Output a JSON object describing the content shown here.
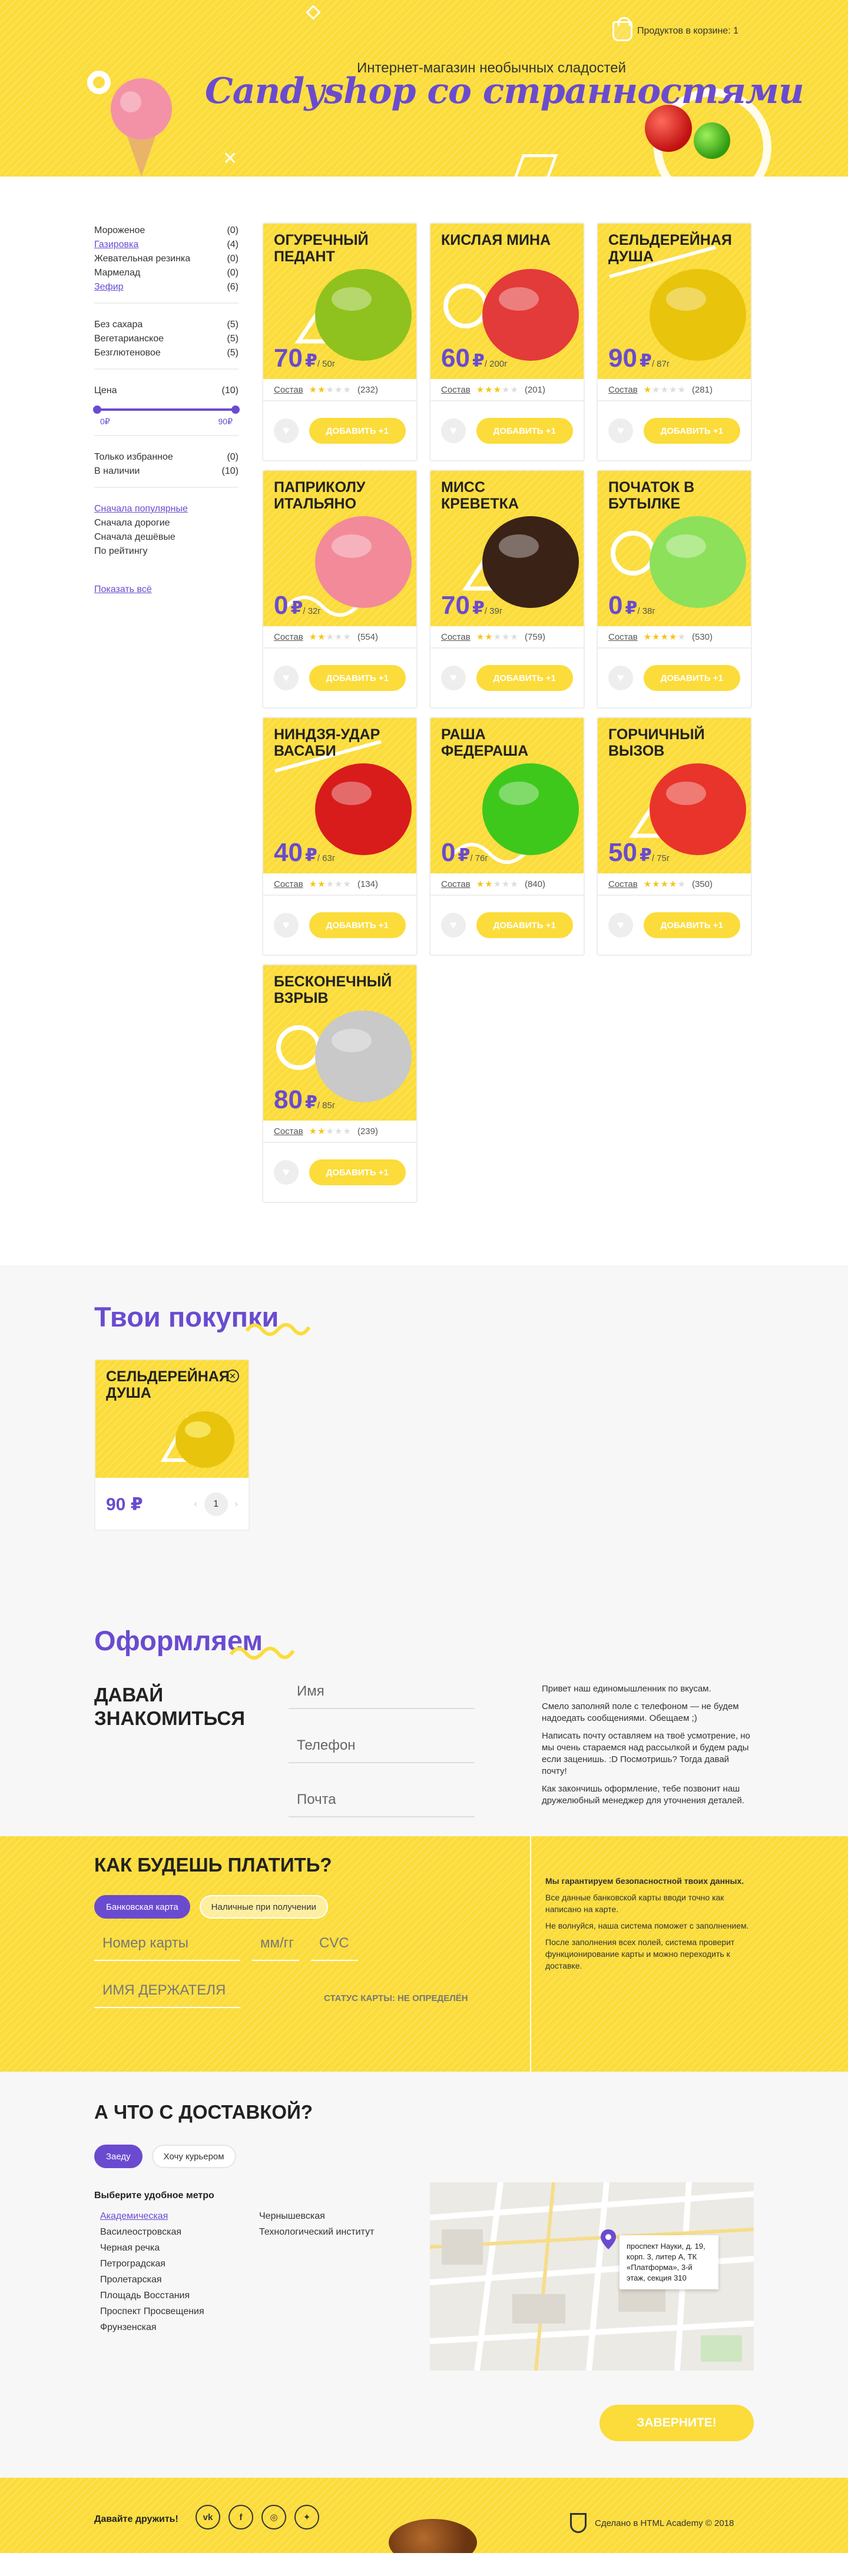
{
  "header": {
    "cart_text": "Продуктов в корзине: 1",
    "tagline": "Интернет-магазин необычных сладостей",
    "logo": "Candyshop со странностями"
  },
  "filters": {
    "categories": [
      {
        "label": "Мороженое",
        "count": "(0)"
      },
      {
        "label": "Газировка",
        "count": "(4)"
      },
      {
        "label": "Жевательная резинка",
        "count": "(0)"
      },
      {
        "label": "Мармелад",
        "count": "(0)"
      },
      {
        "label": "Зефир",
        "count": "(6)"
      }
    ],
    "diet": [
      {
        "label": "Без сахара",
        "count": "(5)"
      },
      {
        "label": "Вегетарианское",
        "count": "(5)"
      },
      {
        "label": "Безглютеновое",
        "count": "(5)"
      }
    ],
    "price_label": "Цена",
    "price_count": "(10)",
    "price_min": "0₽",
    "price_max": "90₽",
    "other": [
      {
        "label": "Только избранное",
        "count": "(0)"
      },
      {
        "label": "В наличии",
        "count": "(10)"
      }
    ],
    "sort": [
      "Сначала популярные",
      "Сначала дорогие",
      "Сначала дешёвые",
      "По рейтингу"
    ],
    "show_all": "Показать всё"
  },
  "products": [
    {
      "name": "Огуречный педант",
      "price": "70",
      "weight": "/ 50г",
      "rating": 2,
      "votes": "(232)",
      "color": "#8fc21e"
    },
    {
      "name": "Кислая мина",
      "price": "60",
      "weight": "/ 200г",
      "rating": 3,
      "votes": "(201)",
      "color": "#e33a3a"
    },
    {
      "name": "Сельдерейная душа",
      "price": "90",
      "weight": "/ 87г",
      "rating": 1,
      "votes": "(281)",
      "color": "#e8c40d"
    },
    {
      "name": "Паприколу итальяно",
      "price": "0",
      "weight": "/ 32г",
      "rating": 2,
      "votes": "(554)",
      "color": "#f28a9a"
    },
    {
      "name": "Мисс креветка",
      "price": "70",
      "weight": "/ 39г",
      "rating": 2,
      "votes": "(759)",
      "color": "#3a2217"
    },
    {
      "name": "Початок в бутылке",
      "price": "0",
      "weight": "/ 38г",
      "rating": 4,
      "votes": "(530)",
      "color": "#8de05a"
    },
    {
      "name": "Ниндзя-удар васаби",
      "price": "40",
      "weight": "/ 63г",
      "rating": 2,
      "votes": "(134)",
      "color": "#d81c1c"
    },
    {
      "name": "Раша федераша",
      "price": "0",
      "weight": "/ 76г",
      "rating": 2,
      "votes": "(840)",
      "color": "#3ec81c"
    },
    {
      "name": "Горчичный вызов",
      "price": "50",
      "weight": "/ 75г",
      "rating": 4,
      "votes": "(350)",
      "color": "#e8342a"
    },
    {
      "name": "Бесконечный взрыв",
      "price": "80",
      "weight": "/ 85г",
      "rating": 2,
      "votes": "(239)",
      "color": "#c9c9c9"
    }
  ],
  "card_labels": {
    "composition": "Состав",
    "add": "Добавить +1",
    "currency": "₽"
  },
  "purchases": {
    "title": "Твои покупки",
    "item_name": "Сельдерейная душа",
    "item_price": "90 ₽",
    "item_qty": "1"
  },
  "order": {
    "title": "Оформляем",
    "meet": "Давай знакомиться",
    "fields": [
      "Имя",
      "Телефон",
      "Почта"
    ],
    "note": [
      "Привет наш единомышленник по вкусам.",
      "Смело заполняй поле с телефоном — не будем надоедать сообщениями. Обещаем ;)",
      "Написать почту оставляем на твоё усмотрение, но мы очень стараемся над рассылкой и будем рады если заценишь. :D Посмотришь? Тогда давай почту!",
      "Как закончишь оформление, тебе позвонит наш дружелюбный менеджер для уточнения деталей."
    ]
  },
  "payment": {
    "title": "Как будешь платить?",
    "tabs": [
      "Банковская карта",
      "Наличные при получении"
    ],
    "card_number": "Номер карты",
    "expiry": "мм/гг",
    "cvc": "CVC",
    "holder": "ИМЯ ДЕРЖАТЕЛЯ",
    "status": "Статус карты: не определён",
    "note": [
      "Мы гарантируем безопасностной твоих данных.",
      "Все данные банковской карты вводи точно как написано на карте.",
      "Не волнуйся, наша система поможет с заполнением.",
      "После заполнения всех полей, система проверит функционирование карты и можно переходить к доставке."
    ]
  },
  "delivery": {
    "title": "А что с доставкой?",
    "tabs": [
      "Заеду",
      "Хочу курьером"
    ],
    "metro_title": "Выберите удобное метро",
    "metro_col1": [
      "Академическая",
      "Василеостровская",
      "Черная речка",
      "Петроградская",
      "Пролетарская",
      "Площадь Восстания",
      "Проспект Просвещения",
      "Фрунзенская"
    ],
    "metro_col2": [
      "Чернышевская",
      "Технологический институт"
    ],
    "address": "проспект Науки, д. 19, корп. 3, литер А, ТК «Платформа», 3-й этаж, секция 310",
    "submit": "Заверните!"
  },
  "footer": {
    "friends": "Давайте дружить!",
    "socials": [
      "vk-icon",
      "facebook-icon",
      "instagram-icon",
      "twitter-icon"
    ],
    "social_glyphs": [
      "vk",
      "f",
      "◎",
      "✦"
    ],
    "copyright": "Сделано в HTML Academy © 2018"
  },
  "colors": {
    "accent": "#6a4bd0",
    "brand_yellow": "#fbdc3a",
    "section_bg": "#f7f7f7"
  }
}
